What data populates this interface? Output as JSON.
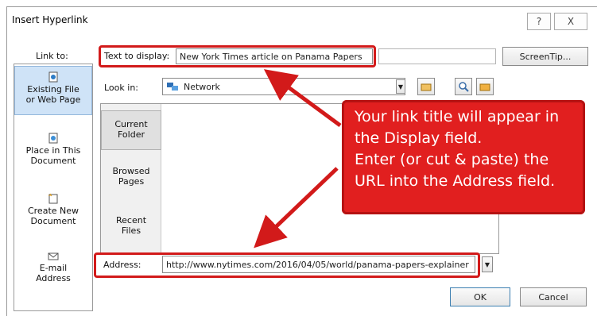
{
  "dialog": {
    "title": "Insert Hyperlink",
    "help_label": "?",
    "close_label": "X"
  },
  "link_to": {
    "label": "Link to:",
    "items": [
      {
        "label_line1": "Existing File",
        "label_line2": "or Web Page"
      },
      {
        "label_line1": "Place in This",
        "label_line2": "Document"
      },
      {
        "label_line1": "Create New",
        "label_line2": "Document"
      },
      {
        "label_line1": "E-mail",
        "label_line2": "Address"
      }
    ]
  },
  "text_to_display": {
    "label": "Text to display:",
    "value": "New York Times article on Panama Papers"
  },
  "screentip_label": "ScreenTip...",
  "look_in": {
    "label": "Look in:",
    "value": "Network"
  },
  "browse": {
    "items": [
      {
        "label_line1": "Current",
        "label_line2": "Folder"
      },
      {
        "label_line1": "Browsed",
        "label_line2": "Pages"
      },
      {
        "label_line1": "Recent",
        "label_line2": "Files"
      }
    ]
  },
  "address": {
    "label": "Address:",
    "value": "http://www.nytimes.com/2016/04/05/world/panama-papers-explainer"
  },
  "buttons": {
    "ok": "OK",
    "cancel": "Cancel"
  },
  "callout": {
    "line1": "Your link title will appear in",
    "line2": "the Display field.",
    "line3": "Enter (or cut & paste) the",
    "line4": "URL into the Address field."
  },
  "colors": {
    "annotation_red": "#d21a1a",
    "callout_fill": "#e11f1f"
  }
}
